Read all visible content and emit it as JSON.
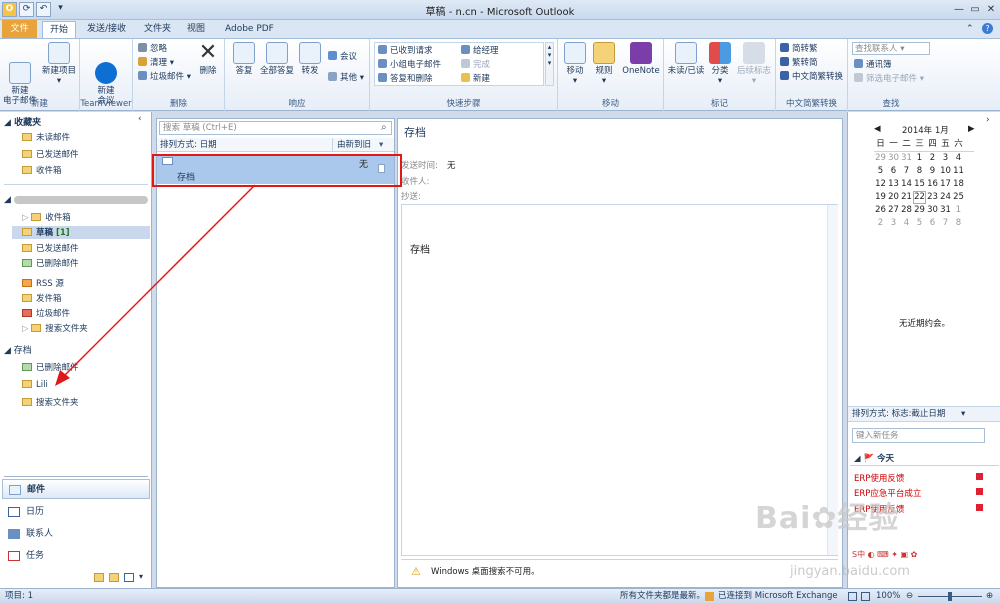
{
  "window": {
    "title": "草稿 -                                        n.cn - Microsoft Outlook"
  },
  "tabs": [
    "文件",
    "开始",
    "发送/接收",
    "文件夹",
    "视图",
    "Adobe PDF"
  ],
  "ribbon": {
    "new": {
      "label": "新建",
      "new_mail": "新建\n电子邮件",
      "new_items": "新建项目"
    },
    "teamviewer": {
      "label": "TeamViewer",
      "meeting": "新建\n会议"
    },
    "delete": {
      "label": "删除",
      "ignore": "忽略",
      "clean": "清理",
      "junk": "垃圾邮件",
      "delete": "删除"
    },
    "respond": {
      "label": "响应",
      "reply": "答复",
      "reply_all": "全部答复",
      "forward": "转发",
      "meeting": "会议",
      "more": "其他"
    },
    "quicksteps": {
      "label": "快速步骤",
      "items": [
        "已收到请求",
        "给经理",
        "小组电子邮件",
        "完成",
        "答复和删除",
        "新建"
      ]
    },
    "move": {
      "label": "移动",
      "move": "移动",
      "rules": "规则",
      "onenote": "OneNote"
    },
    "tags": {
      "label": "标记",
      "unread": "未读/已读",
      "categorize": "分类",
      "followup": "后续标志"
    },
    "chinese": {
      "label": "中文简繁转换",
      "to_trad": "简转繁",
      "to_simp": "繁转简",
      "convert": "中文简繁转换"
    },
    "find": {
      "label": "查找",
      "search_contacts": "查找联系人",
      "address_book": "通讯簿",
      "filter": "筛选电子邮件"
    }
  },
  "nav": {
    "favorites_header": "收藏夹",
    "favorites": [
      "未读邮件",
      "已发送邮件",
      "收件箱"
    ],
    "account_items": [
      "收件箱",
      "草稿",
      "[1]",
      "已发送邮件",
      "已删除邮件",
      "RSS 源",
      "发件箱",
      "垃圾邮件",
      "搜索文件夹"
    ],
    "archive_header": "存档",
    "archive_items": [
      "已删除邮件",
      "Lili",
      "搜索文件夹"
    ],
    "bottom": [
      "邮件",
      "日历",
      "联系人",
      "任务"
    ]
  },
  "message_list": {
    "search_placeholder": "搜索 草稿 (Ctrl+E)",
    "sort_label": "排列方式: 日期",
    "sort_order": "由新到旧",
    "message": {
      "subject": "存档",
      "date": "无"
    }
  },
  "reading": {
    "subject": "存档",
    "sent_label": "发送时间:",
    "sent_value": "无",
    "to_label": "收件人:",
    "cc_label": "抄送:",
    "body": "存档",
    "warning": "Windows 桌面搜索不可用。"
  },
  "todo": {
    "month": "2014年 1月",
    "weekdays": [
      "日",
      "一",
      "二",
      "三",
      "四",
      "五",
      "六"
    ],
    "weeks": [
      [
        "29",
        "30",
        "31",
        "1",
        "2",
        "3",
        "4"
      ],
      [
        "5",
        "6",
        "7",
        "8",
        "9",
        "10",
        "11"
      ],
      [
        "12",
        "13",
        "14",
        "15",
        "16",
        "17",
        "18"
      ],
      [
        "19",
        "20",
        "21",
        "22",
        "23",
        "24",
        "25"
      ],
      [
        "26",
        "27",
        "28",
        "29",
        "30",
        "31",
        "1"
      ],
      [
        "2",
        "3",
        "4",
        "5",
        "6",
        "7",
        "8"
      ]
    ],
    "no_appointments": "无近期约会。",
    "task_sort": "排列方式: 标志:截止日期",
    "new_task_placeholder": "键入新任务",
    "today": "今天",
    "tasks": [
      "ERP使用反馈",
      "ERP应急平台成立",
      "ERP使用反馈"
    ]
  },
  "status": {
    "items": "项目: 1",
    "updated": "所有文件夹都是最新。",
    "exchange": "已连接到 Microsoft Exchange",
    "zoom": "100%"
  },
  "colors": {
    "accent": "#e8a33a",
    "selection": "#a9c8ec",
    "annotation": "#e01818"
  }
}
